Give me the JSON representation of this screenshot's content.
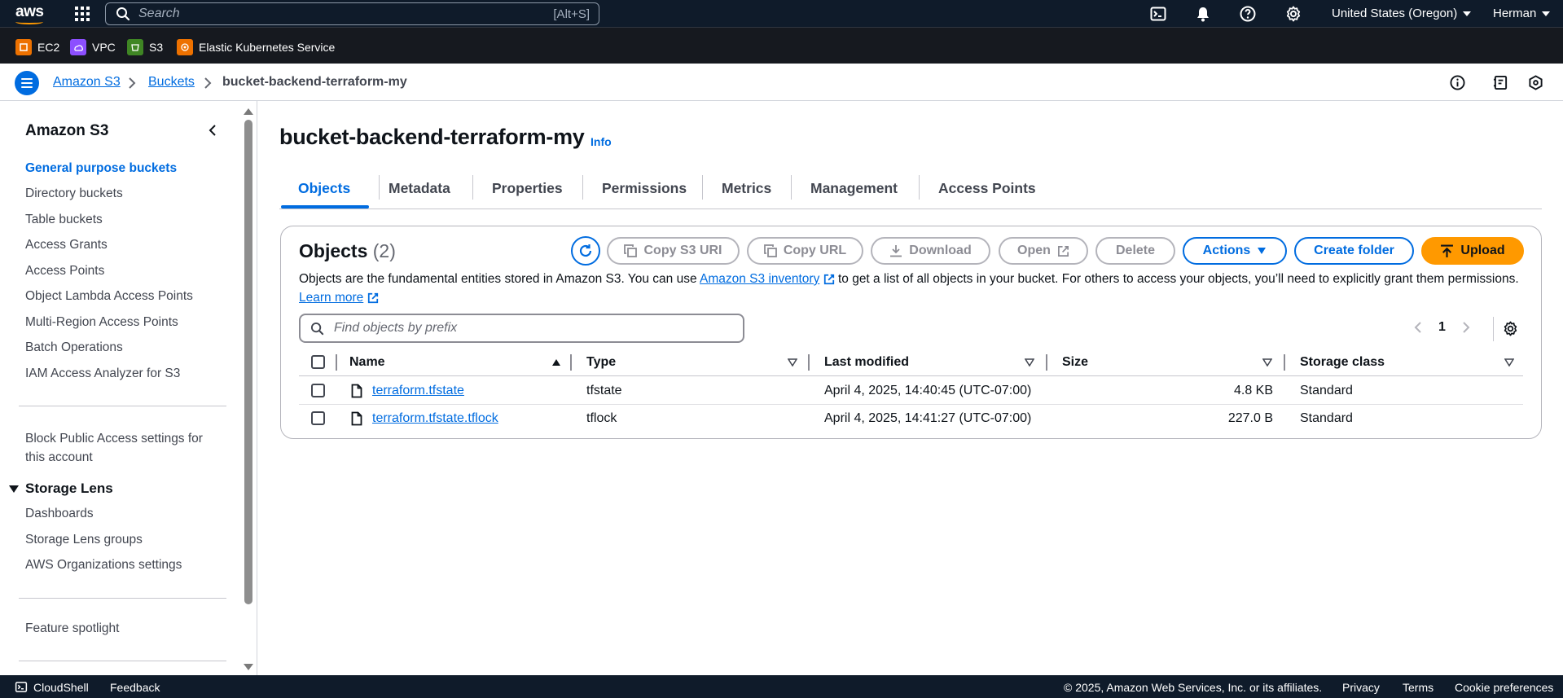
{
  "topnav": {
    "logo": "aws",
    "search_placeholder": "Search",
    "search_shortcut": "[Alt+S]",
    "region": "United States (Oregon)",
    "user": "Herman"
  },
  "favorites": [
    {
      "label": "EC2",
      "color": "#ed7100"
    },
    {
      "label": "VPC",
      "color": "#8c4fff"
    },
    {
      "label": "S3",
      "color": "#3f8624"
    },
    {
      "label": "Elastic Kubernetes Service",
      "color": "#ed7100"
    }
  ],
  "breadcrumbs": [
    "Amazon S3",
    "Buckets",
    "bucket-backend-terraform-my"
  ],
  "sidebar": {
    "title": "Amazon S3",
    "items": [
      "General purpose buckets",
      "Directory buckets",
      "Table buckets",
      "Access Grants",
      "Access Points",
      "Object Lambda Access Points",
      "Multi-Region Access Points",
      "Batch Operations",
      "IAM Access Analyzer for S3"
    ],
    "block_public": "Block Public Access settings for this account",
    "storage_lens": {
      "title": "Storage Lens",
      "items": [
        "Dashboards",
        "Storage Lens groups",
        "AWS Organizations settings"
      ]
    },
    "feature_spotlight": "Feature spotlight"
  },
  "page": {
    "title": "bucket-backend-terraform-my",
    "info": "Info",
    "tabs": [
      "Objects",
      "Metadata",
      "Properties",
      "Permissions",
      "Metrics",
      "Management",
      "Access Points"
    ]
  },
  "objects_panel": {
    "title": "Objects",
    "count": "(2)",
    "buttons": {
      "copy_uri": "Copy S3 URI",
      "copy_url": "Copy URL",
      "download": "Download",
      "open": "Open",
      "delete": "Delete",
      "actions": "Actions",
      "create_folder": "Create folder",
      "upload": "Upload"
    },
    "desc_1": "Objects are the fundamental entities stored in Amazon S3. You can use ",
    "desc_link": "Amazon S3 inventory",
    "desc_2": " to get a list of all objects in your bucket. For others to access your objects, you’ll need to explicitly grant them permissions. ",
    "learn_more": "Learn more",
    "filter_placeholder": "Find objects by prefix",
    "page_number": "1",
    "columns": [
      "Name",
      "Type",
      "Last modified",
      "Size",
      "Storage class"
    ],
    "rows": [
      {
        "name": "terraform.tfstate",
        "type": "tfstate",
        "modified": "April 4, 2025, 14:40:45 (UTC-07:00)",
        "size": "4.8 KB",
        "class": "Standard"
      },
      {
        "name": "terraform.tfstate.tflock",
        "type": "tflock",
        "modified": "April 4, 2025, 14:41:27 (UTC-07:00)",
        "size": "227.0 B",
        "class": "Standard"
      }
    ]
  },
  "footer": {
    "cloudshell": "CloudShell",
    "feedback": "Feedback",
    "copyright": "© 2025, Amazon Web Services, Inc. or its affiliates.",
    "privacy": "Privacy",
    "terms": "Terms",
    "cookies": "Cookie preferences"
  }
}
